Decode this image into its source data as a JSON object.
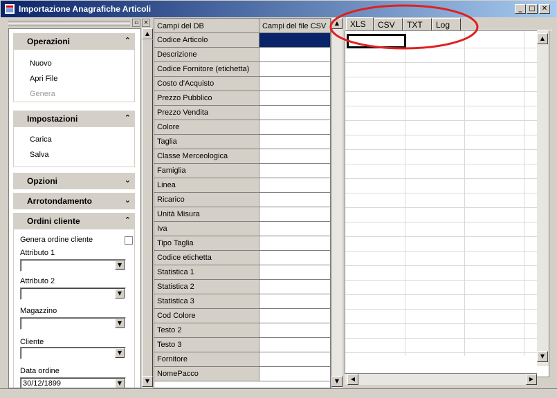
{
  "window": {
    "title": "Importazione Anagrafiche Articoli"
  },
  "title_buttons": {
    "minimize": "_",
    "maximize": "□",
    "close": "✕"
  },
  "taskpane": {
    "pin_glyph": "▫",
    "close_glyph": "×",
    "sections": {
      "operazioni": {
        "title": "Operazioni",
        "expanded": true,
        "items": [
          "Nuovo",
          "Apri File",
          "Genera"
        ],
        "disabled_items": [
          "Genera"
        ]
      },
      "impostazioni": {
        "title": "Impostazioni",
        "expanded": true,
        "items": [
          "Carica",
          "Salva"
        ]
      },
      "opzioni": {
        "title": "Opzioni",
        "expanded": false
      },
      "arrotondamento": {
        "title": "Arrotondamento",
        "expanded": false
      },
      "ordini": {
        "title": "Ordini cliente",
        "expanded": true,
        "genera_label": "Genera ordine cliente",
        "genera_checked": false,
        "attributo1_label": "Attributo 1",
        "attributo1_value": "",
        "attributo2_label": "Attributo 2",
        "attributo2_value": "",
        "magazzino_label": "Magazzino",
        "magazzino_value": "",
        "cliente_label": "Cliente",
        "cliente_value": "",
        "data_label": "Data ordine",
        "data_value": "30/12/1899"
      }
    },
    "chevron_up": "⌃",
    "chevron_down": "⌄"
  },
  "mapping_grid": {
    "headers": [
      "Campi del DB",
      "Campi del file CSV"
    ],
    "rows": [
      "Codice Articolo",
      "Descrizione",
      "Codice Fornitore (etichetta)",
      "Costo d'Acquisto",
      "Prezzo Pubblico",
      "Prezzo Vendita",
      "Colore",
      "Taglia",
      "Classe Merceologica",
      "Famiglia",
      "Linea",
      "Ricarico",
      "Unità Misura",
      "Iva",
      "Tipo Taglia",
      "Codice etichetta",
      "Statistica 1",
      "Statistica 2",
      "Statistica 3",
      "Cod Colore",
      "Testo 2",
      "Testo 3",
      "Fornitore",
      "NomePacco"
    ],
    "selected_row": 0
  },
  "tabs": [
    "XLS",
    "CSV",
    "TXT",
    "Log"
  ],
  "active_tab": "XLS",
  "annotation_color": "#e02020",
  "scroll_glyphs": {
    "up": "▲",
    "down": "▼",
    "left": "◀",
    "right": "▶"
  }
}
